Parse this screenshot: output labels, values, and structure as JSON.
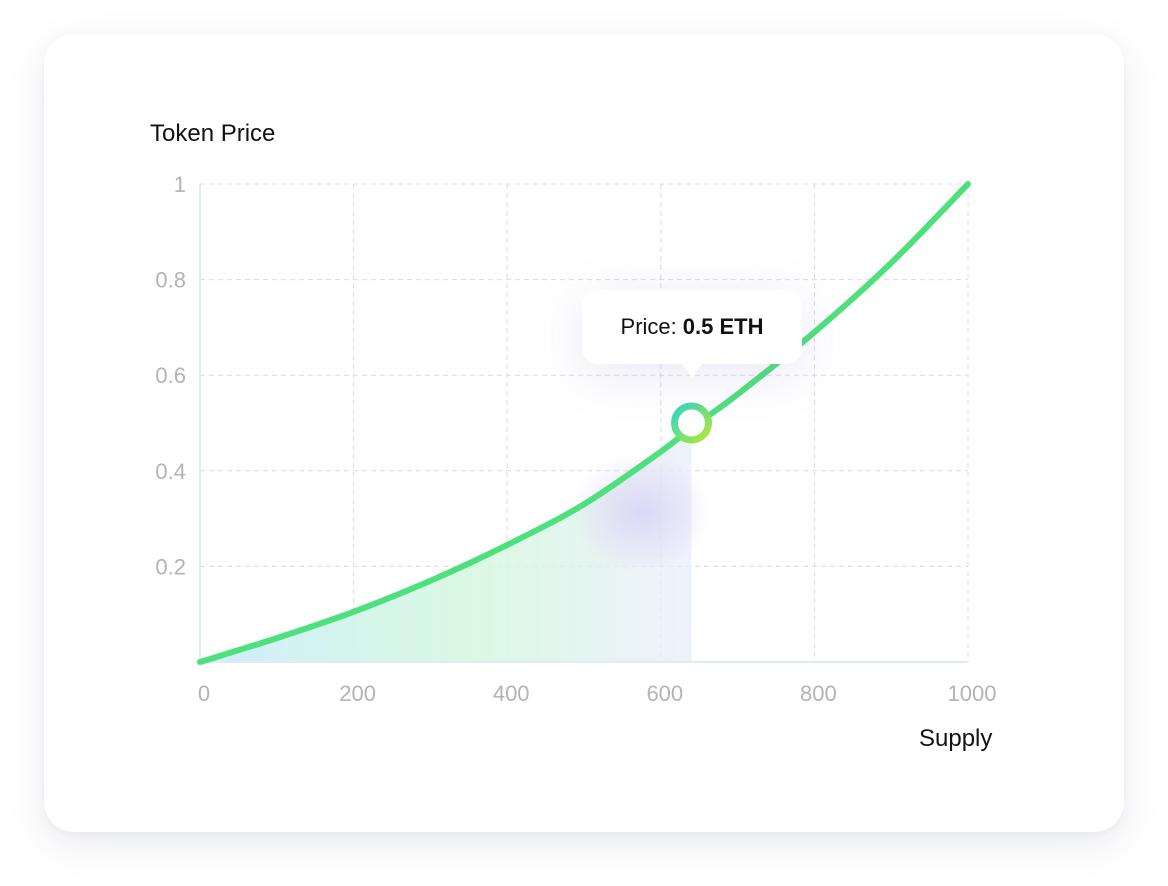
{
  "chart_data": {
    "type": "area",
    "title": "",
    "ylabel": "Token Price",
    "xlabel": "Supply",
    "xlim": [
      0,
      1000
    ],
    "ylim": [
      0,
      1
    ],
    "x_ticks": [
      "0",
      "200",
      "400",
      "600",
      "800",
      "1000"
    ],
    "y_ticks": [
      "0.2",
      "0.4",
      "0.6",
      "0.8",
      "1"
    ],
    "grid": true,
    "series": [
      {
        "x": [
          0,
          100,
          200,
          300,
          400,
          500,
          600,
          640,
          700,
          800,
          900,
          1000
        ],
        "y": [
          0,
          0.05,
          0.105,
          0.17,
          0.245,
          0.33,
          0.44,
          0.49,
          0.56,
          0.69,
          0.835,
          1.0
        ],
        "color": "#4ee07d"
      }
    ],
    "highlight": {
      "x": 640,
      "y": 0.5,
      "shaded_to_x": 640
    },
    "tooltip": {
      "label": "Price:",
      "value": "0.5 ETH"
    }
  },
  "colors": {
    "line": "#4ee07d",
    "grid": "#dcdce0",
    "tick_text": "#b3b3b8",
    "marker_gradient": [
      "#2fd6c8",
      "#a8e63a"
    ]
  }
}
